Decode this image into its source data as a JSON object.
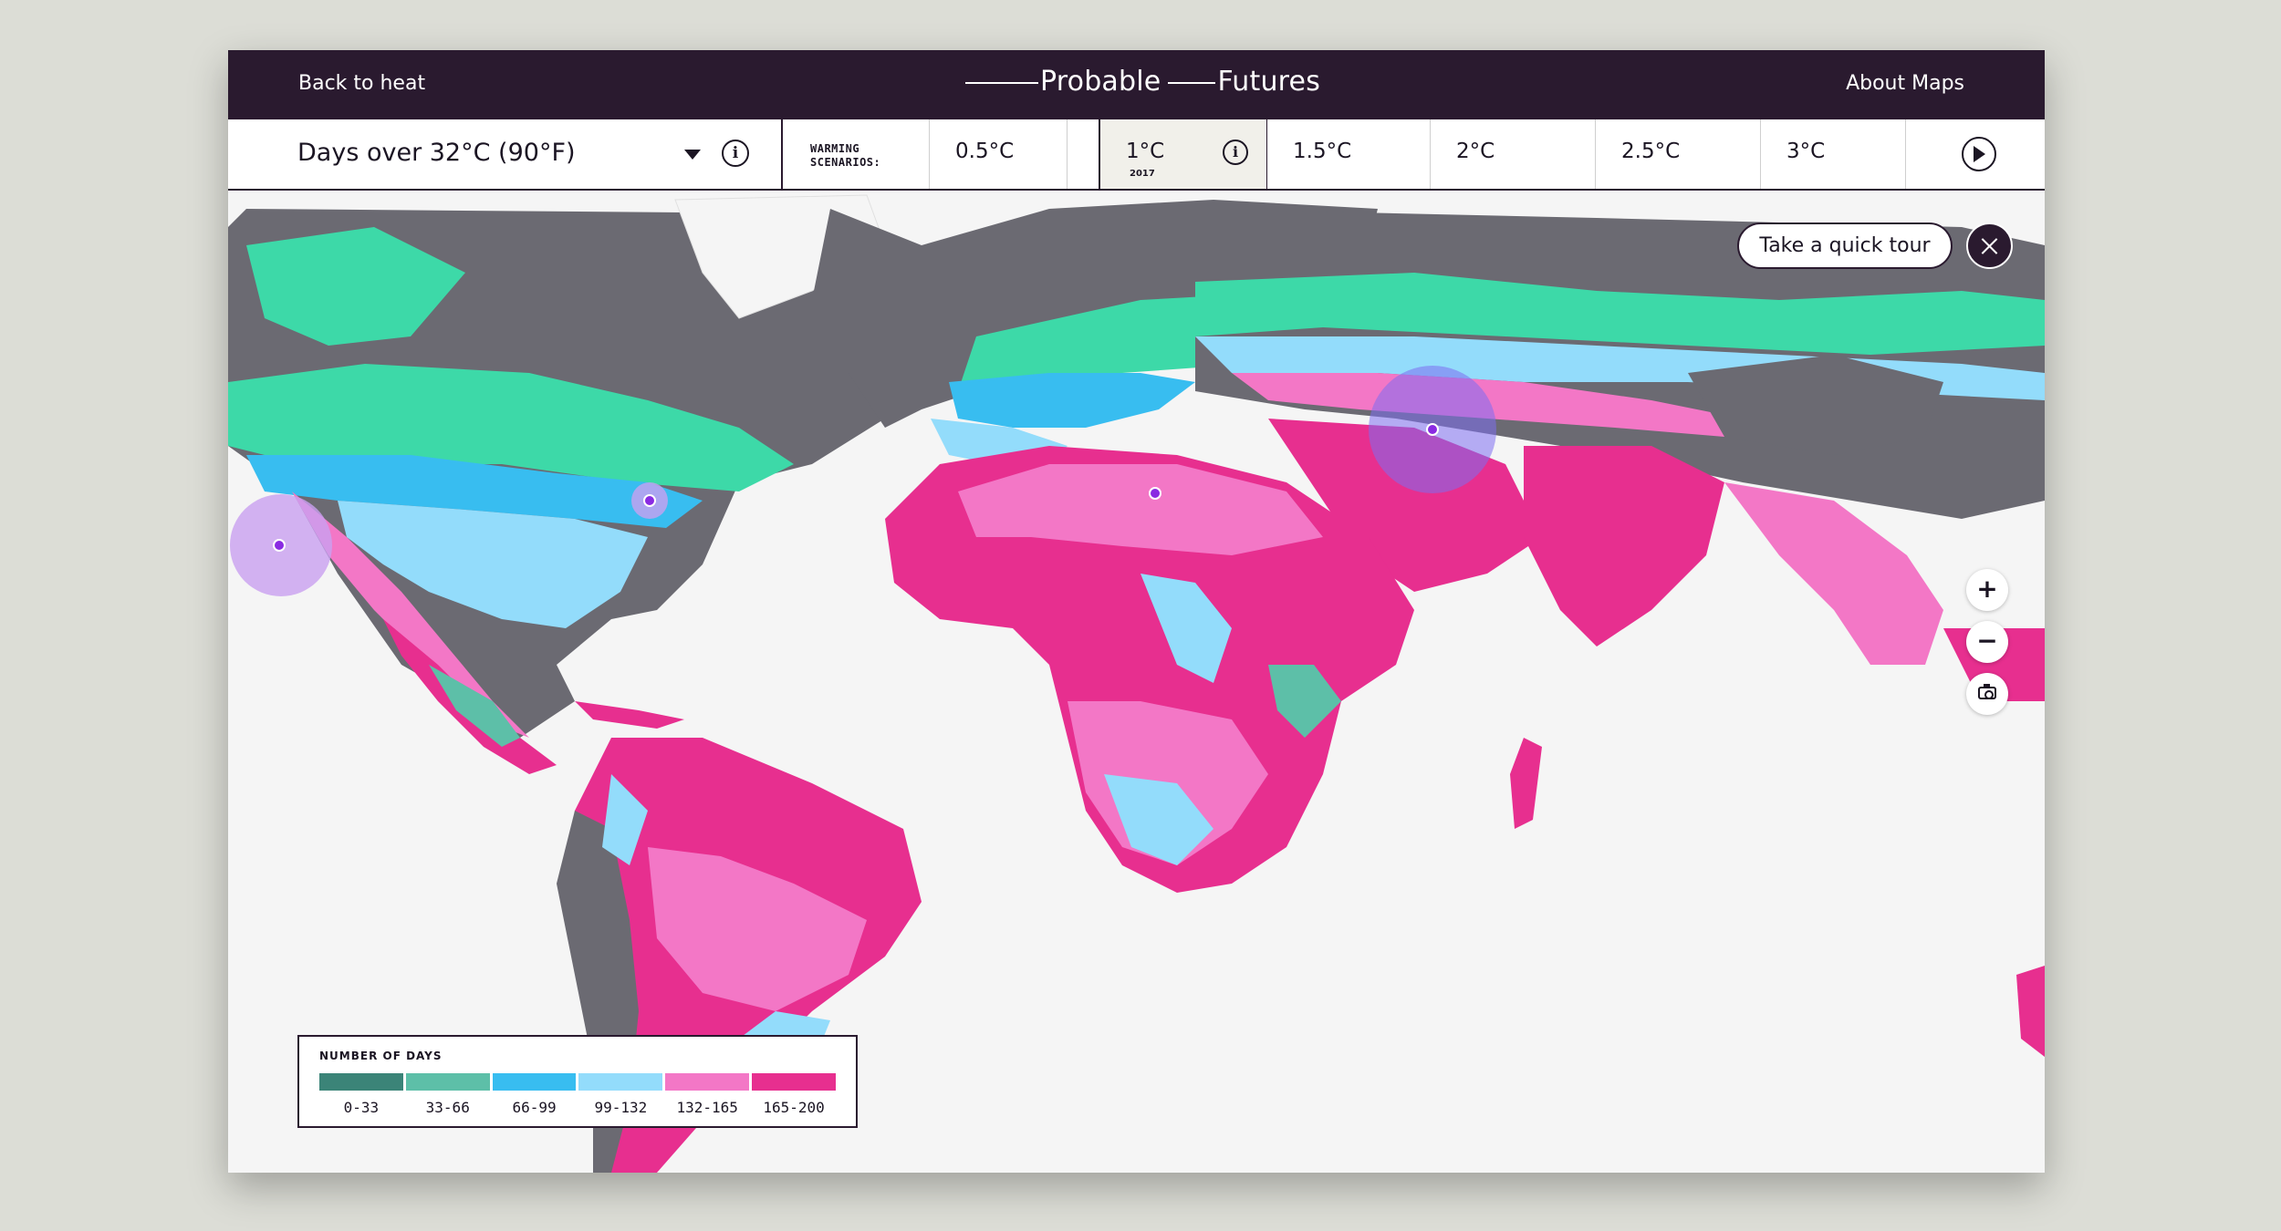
{
  "header": {
    "back_link": "Back to heat",
    "brand_word1": "Probable",
    "brand_word2": "Futures",
    "about_link": "About Maps"
  },
  "metric": {
    "label": "Days over 32°C (90°F)"
  },
  "warming": {
    "title": "WARMING SCENARIOS:",
    "scenarios": [
      {
        "label": "0.5°C",
        "year": ""
      },
      {
        "label": "1°C",
        "year": "2017"
      },
      {
        "label": "1.5°C",
        "year": ""
      },
      {
        "label": "2°C",
        "year": ""
      },
      {
        "label": "2.5°C",
        "year": ""
      },
      {
        "label": "3°C",
        "year": ""
      }
    ],
    "selected": "1°C"
  },
  "tour": {
    "button_label": "Take a quick tour"
  },
  "zoom": {
    "in_label": "+",
    "out_label": "−"
  },
  "icons": [
    "chevron-down-icon",
    "info-icon",
    "play-icon",
    "close-icon",
    "camera-icon"
  ],
  "legend": {
    "title": "NUMBER OF DAYS",
    "bins": [
      {
        "label": "0-33",
        "color": "#3b8478"
      },
      {
        "label": "33-66",
        "color": "#5dbfa8"
      },
      {
        "label": "66-99",
        "color": "#38bdf0"
      },
      {
        "label": "99-132",
        "color": "#93dcfb"
      },
      {
        "label": "132-165",
        "color": "#f377c6"
      },
      {
        "label": "165-200",
        "color": "#e72f8f"
      }
    ]
  },
  "colors": {
    "header_bg": "#2a1a2f",
    "water": "#f5f5f5",
    "no_data_land": "#6b6a72",
    "cold_land": "#3dd9a8"
  }
}
